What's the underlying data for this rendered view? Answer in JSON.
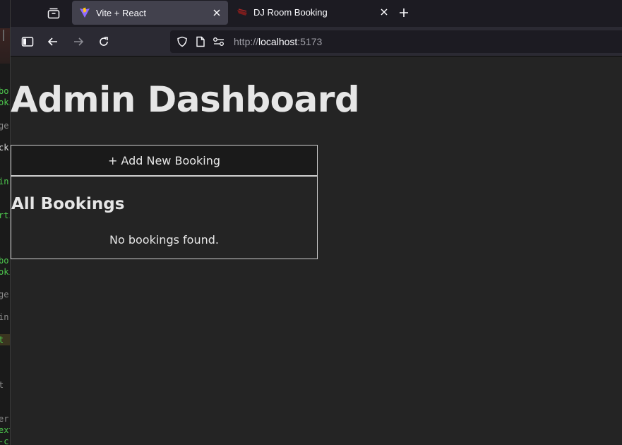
{
  "browser": {
    "tabs": [
      {
        "title": "Vite + React",
        "active": true,
        "favicon": "vite-icon"
      },
      {
        "title": "DJ Room Booking",
        "active": false,
        "favicon": "dj-icon"
      }
    ],
    "url": {
      "scheme": "http://",
      "host": "localhost",
      "port": ":5173"
    }
  },
  "page": {
    "title": "Admin Dashboard",
    "add_button_label": "+ Add New Booking",
    "bookings_heading": "All Bookings",
    "empty_message": "No bookings found."
  },
  "colors": {
    "page_bg": "#242424",
    "text": "#e6e6e6",
    "button_bg": "#1a1a1a",
    "border": "#d0d0d0"
  }
}
